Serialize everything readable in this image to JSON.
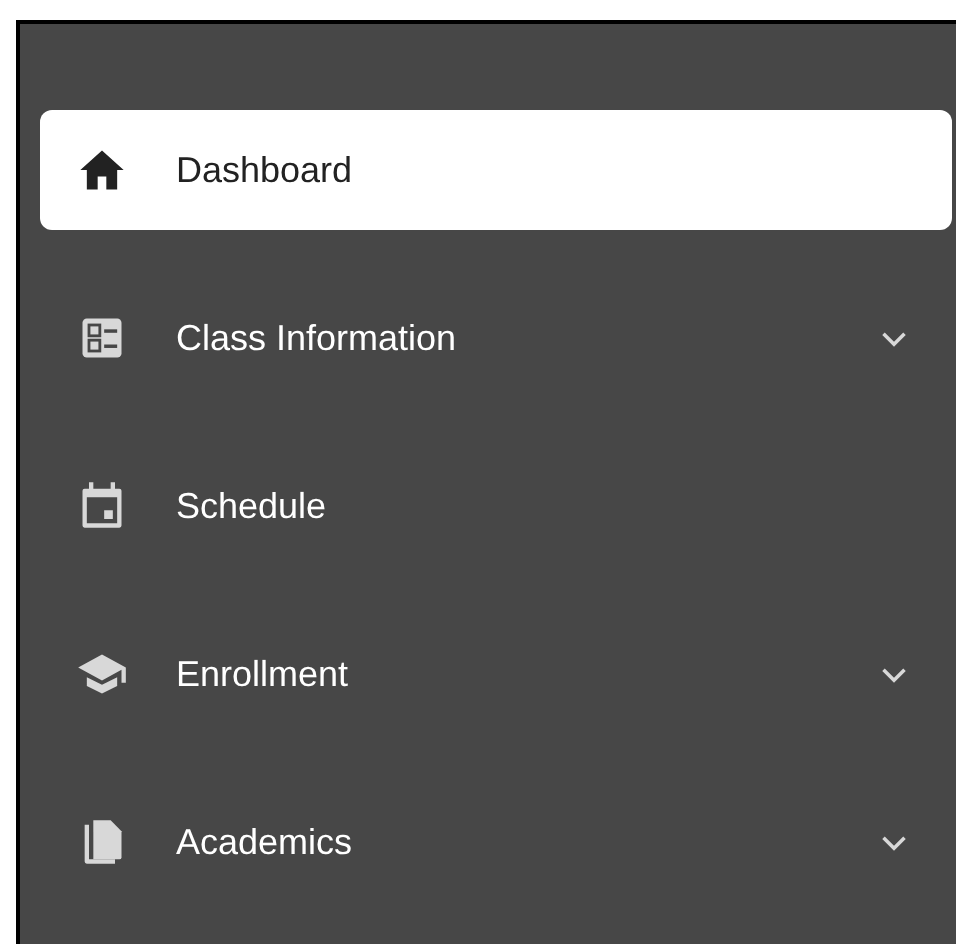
{
  "sidebar": {
    "items": [
      {
        "label": "Dashboard",
        "selected": true,
        "expandable": false
      },
      {
        "label": "Class Information",
        "selected": false,
        "expandable": true
      },
      {
        "label": "Schedule",
        "selected": false,
        "expandable": false
      },
      {
        "label": "Enrollment",
        "selected": false,
        "expandable": true
      },
      {
        "label": "Academics",
        "selected": false,
        "expandable": true
      }
    ]
  }
}
